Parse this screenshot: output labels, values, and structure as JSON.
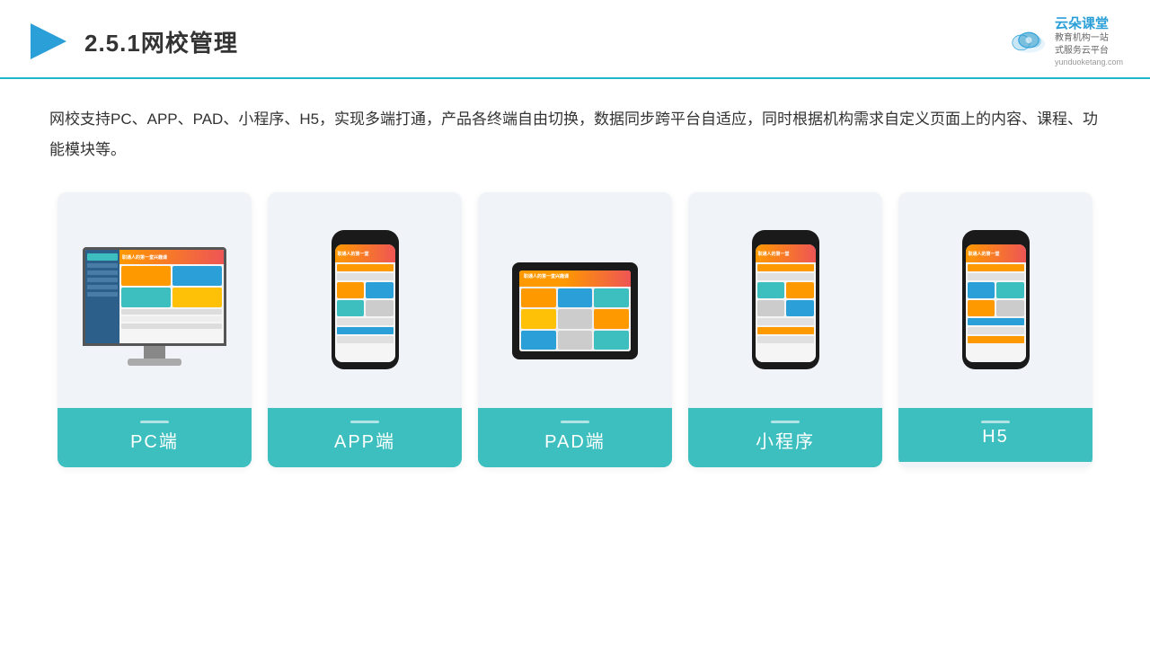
{
  "header": {
    "title": "2.5.1网校管理",
    "logo_main": "云朵课堂",
    "logo_url": "yunduoketang.com",
    "logo_tagline": "教育机构一站\n式服务云平台"
  },
  "description": "网校支持PC、APP、PAD、小程序、H5，实现多端打通，产品各终端自由切换，数据同步跨平台自适应，同时根据机构需求自定义页面上的内容、课程、功能模块等。",
  "cards": [
    {
      "label": "PC端",
      "type": "pc"
    },
    {
      "label": "APP端",
      "type": "phone"
    },
    {
      "label": "PAD端",
      "type": "pad"
    },
    {
      "label": "小程序",
      "type": "phone2"
    },
    {
      "label": "H5",
      "type": "phone3"
    }
  ],
  "brand": {
    "accent_color": "#3dbfbf",
    "header_line_color": "#1cb8c8"
  }
}
